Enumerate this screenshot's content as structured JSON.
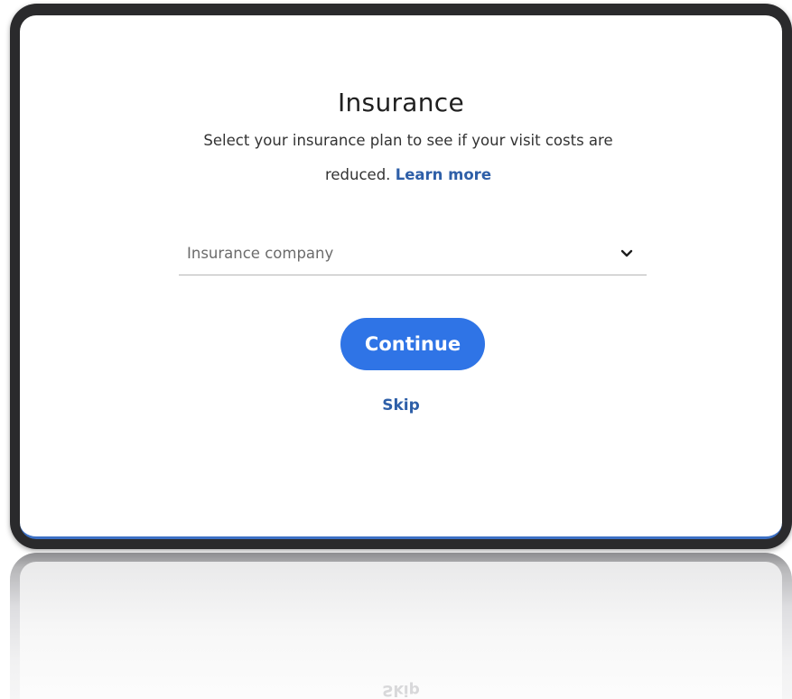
{
  "dialog": {
    "title": "Insurance",
    "description": "Select your insurance plan to see if your visit costs are reduced.",
    "learn_more_label": "Learn more",
    "insurance_select": {
      "placeholder": "Insurance company"
    },
    "continue_label": "Continue",
    "skip_label": "Skip"
  },
  "colors": {
    "primary": "#2f74e6",
    "link": "#2e5fa8",
    "frame": "#2a2a2c"
  },
  "icons": {
    "select_indicator": "chevron-down-icon"
  }
}
